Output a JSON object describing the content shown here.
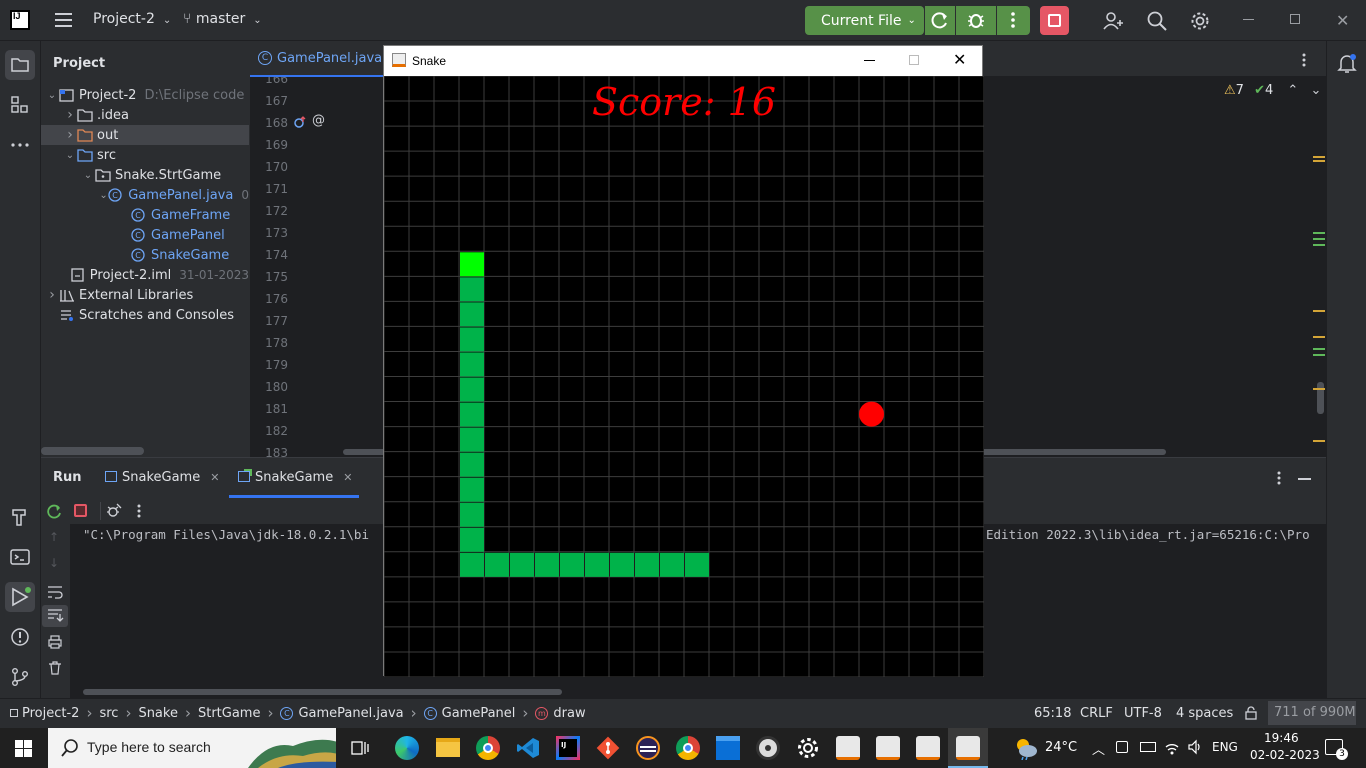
{
  "titlebar": {
    "project": "Project-2",
    "branch": "master",
    "run_config": "Current File",
    "app_icon": "IJ"
  },
  "project_panel": {
    "title": "Project",
    "items": [
      {
        "label": "Project-2",
        "extra": "D:\\Eclipse code",
        "indent": 0,
        "arrow": "open",
        "icon": "module"
      },
      {
        "label": ".idea",
        "extra": "",
        "indent": 1,
        "arrow": "closed",
        "icon": "folder"
      },
      {
        "label": "out",
        "extra": "",
        "indent": 1,
        "arrow": "closed",
        "icon": "folder-orange"
      },
      {
        "label": "src",
        "extra": "",
        "indent": 1,
        "arrow": "open",
        "icon": "folder-src"
      },
      {
        "label": "Snake.StrtGame",
        "extra": "",
        "indent": 2,
        "arrow": "open",
        "icon": "package"
      },
      {
        "label": "GamePanel.java",
        "extra": "0",
        "indent": 3,
        "arrow": "open",
        "icon": "class"
      },
      {
        "label": "GameFrame",
        "extra": "",
        "indent": 4,
        "arrow": "",
        "icon": "class"
      },
      {
        "label": "GamePanel",
        "extra": "",
        "indent": 4,
        "arrow": "",
        "icon": "class"
      },
      {
        "label": "SnakeGame",
        "extra": "",
        "indent": 4,
        "arrow": "",
        "icon": "class"
      },
      {
        "label": "Project-2.iml",
        "extra": "31-01-2023",
        "indent": 1,
        "arrow": "",
        "icon": "file"
      },
      {
        "label": "External Libraries",
        "extra": "",
        "indent": 0,
        "arrow": "closed",
        "icon": "library"
      },
      {
        "label": "Scratches and Consoles",
        "extra": "",
        "indent": 0,
        "arrow": "",
        "icon": "scratch"
      }
    ]
  },
  "editor": {
    "tab": "GamePanel.java",
    "line_numbers": [
      "166",
      "167",
      "168",
      "169",
      "170",
      "171",
      "172",
      "173",
      "174",
      "175",
      "176",
      "177",
      "178",
      "179",
      "180",
      "181",
      "182",
      "183"
    ],
    "warnings": "7",
    "checks": "4"
  },
  "snake_window": {
    "title": "Snake",
    "score_text": "Score: 16",
    "snake_cells": [
      [
        3,
        7
      ],
      [
        3,
        8
      ],
      [
        3,
        9
      ],
      [
        3,
        10
      ],
      [
        3,
        11
      ],
      [
        3,
        12
      ],
      [
        3,
        13
      ],
      [
        3,
        14
      ],
      [
        3,
        15
      ],
      [
        3,
        16
      ],
      [
        3,
        17
      ],
      [
        3,
        18
      ],
      [
        3,
        19
      ],
      [
        4,
        19
      ],
      [
        5,
        19
      ],
      [
        6,
        19
      ],
      [
        7,
        19
      ],
      [
        8,
        19
      ],
      [
        9,
        19
      ],
      [
        10,
        19
      ],
      [
        11,
        19
      ],
      [
        12,
        19
      ]
    ],
    "head": [
      3,
      7
    ],
    "apple": [
      19,
      13
    ],
    "grid_cols": 24,
    "grid_rows": 24
  },
  "run_panel": {
    "title": "Run",
    "tabs": [
      "SnakeGame",
      "SnakeGame"
    ],
    "cmd_left": "\"C:\\Program Files\\Java\\jdk-18.0.2.1\\bi",
    "cmd_right": "Edition 2022.3\\lib\\idea_rt.jar=65216:C:\\Pro"
  },
  "statusbar": {
    "breadcrumbs": [
      "Project-2",
      "src",
      "Snake",
      "StrtGame",
      "GamePanel.java",
      "GamePanel",
      "draw"
    ],
    "position": "65:18",
    "line_ending": "CRLF",
    "encoding": "UTF-8",
    "indent": "4 spaces",
    "memory": "711 of 990M"
  },
  "taskbar": {
    "search_placeholder": "Type here to search",
    "weather": "24°C",
    "lang": "ENG",
    "time": "19:46",
    "date": "02-02-2023",
    "notifications": "3"
  },
  "colors": {
    "accent_green": "#579148",
    "snake_head": "#00ff00",
    "snake_body": "#00b34a",
    "apple": "#ff0000",
    "score": "#ff0000"
  }
}
